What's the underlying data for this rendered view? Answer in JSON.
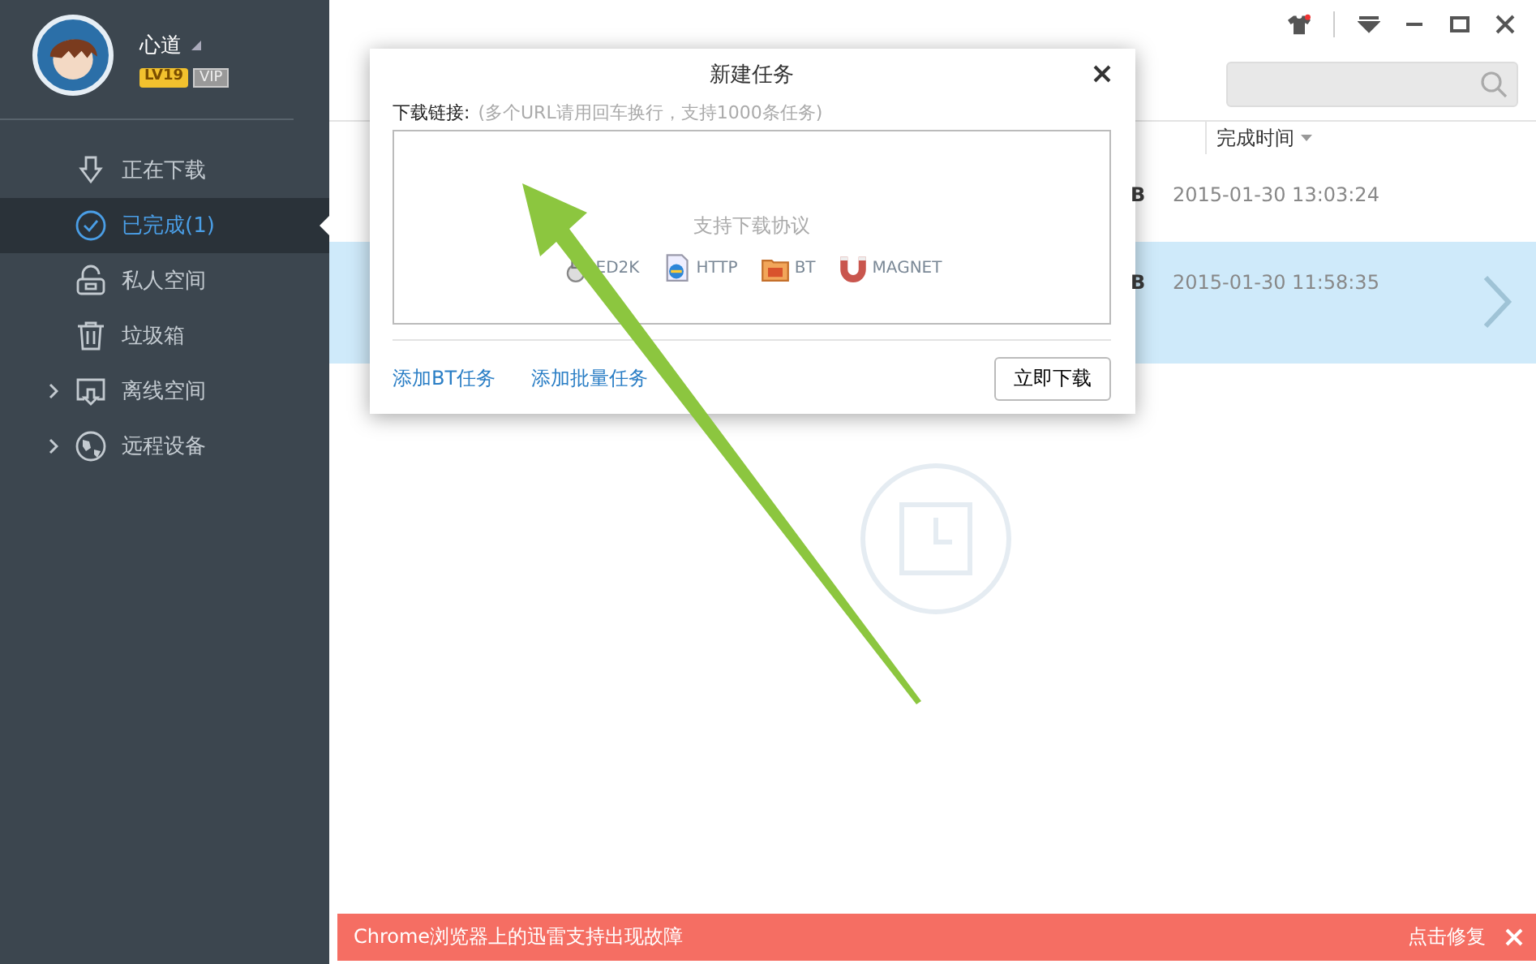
{
  "user": {
    "name": "心道",
    "level": "LV19",
    "vip": "VIP"
  },
  "sidebar": {
    "items": [
      {
        "kind": "download",
        "label": "正在下载",
        "selected": false,
        "expandable": false
      },
      {
        "kind": "done",
        "label": "已完成(1)",
        "selected": true,
        "expandable": false
      },
      {
        "kind": "lock",
        "label": "私人空间",
        "selected": false,
        "expandable": false
      },
      {
        "kind": "trash",
        "label": "垃圾箱",
        "selected": false,
        "expandable": false
      },
      {
        "kind": "cloud",
        "label": "离线空间",
        "selected": false,
        "expandable": true
      },
      {
        "kind": "remote",
        "label": "远程设备",
        "selected": false,
        "expandable": true
      }
    ]
  },
  "table": {
    "columns": [
      {
        "label": "完成时间"
      }
    ],
    "rows": [
      {
        "size": "B",
        "time": "2015-01-30 13:03:24",
        "selected": false
      },
      {
        "size": "B",
        "time": "2015-01-30 11:58:35",
        "selected": true
      }
    ]
  },
  "dialog": {
    "title": "新建任务",
    "label": "下载链接:",
    "hint": "(多个URL请用回车换行，支持1000条任务)",
    "protocols_title": "支持下载协议",
    "protocols": [
      {
        "kind": "ed2k",
        "label": "ED2K"
      },
      {
        "kind": "http",
        "label": "HTTP"
      },
      {
        "kind": "bt",
        "label": "BT"
      },
      {
        "kind": "magnet",
        "label": "MAGNET"
      }
    ],
    "links": [
      "添加BT任务",
      "添加批量任务"
    ],
    "button": "立即下载"
  },
  "notice": {
    "text": "Chrome浏览器上的迅雷支持出现故障",
    "action": "点击修复"
  }
}
